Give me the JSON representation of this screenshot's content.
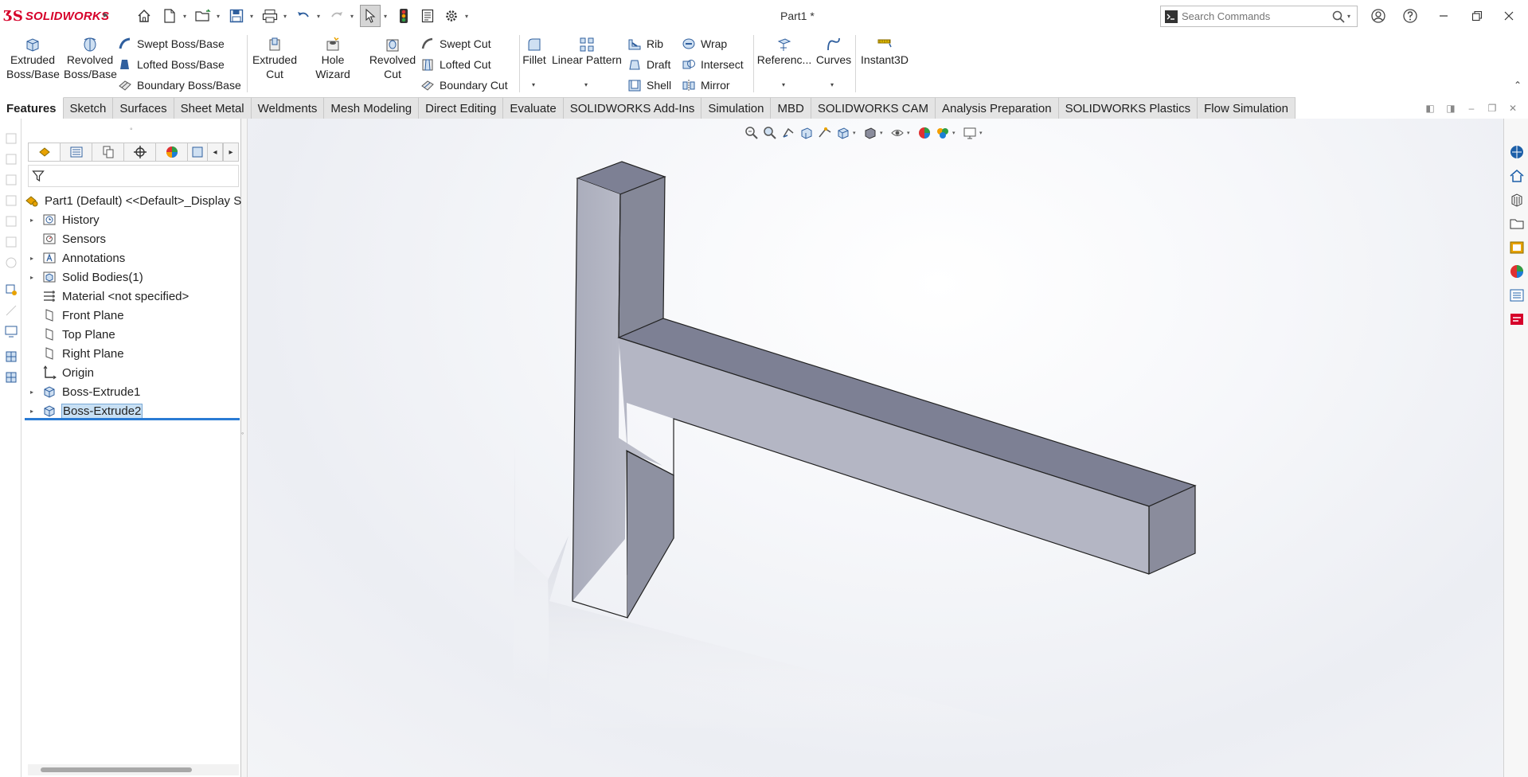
{
  "app": {
    "logo_text": "SOLIDWORKS",
    "document_title": "Part1 *"
  },
  "search": {
    "placeholder": "Search Commands",
    "value": ""
  },
  "commands": {
    "extruded_boss": "Extruded\nBoss/Base",
    "revolved_boss": "Revolved\nBoss/Base",
    "swept_boss": "Swept Boss/Base",
    "lofted_boss": "Lofted Boss/Base",
    "boundary_boss": "Boundary Boss/Base",
    "extruded_cut": "Extruded\nCut",
    "hole_wizard": "Hole Wizard",
    "revolved_cut": "Revolved\nCut",
    "swept_cut": "Swept Cut",
    "lofted_cut": "Lofted Cut",
    "boundary_cut": "Boundary Cut",
    "fillet": "Fillet",
    "linear_pattern": "Linear Pattern",
    "rib": "Rib",
    "draft": "Draft",
    "shell": "Shell",
    "wrap": "Wrap",
    "intersect": "Intersect",
    "mirror": "Mirror",
    "reference": "Referenc...",
    "curves": "Curves",
    "instant3d": "Instant3D"
  },
  "tabs": [
    {
      "label": "Features",
      "active": true
    },
    {
      "label": "Sketch"
    },
    {
      "label": "Surfaces"
    },
    {
      "label": "Sheet Metal"
    },
    {
      "label": "Weldments"
    },
    {
      "label": "Mesh Modeling"
    },
    {
      "label": "Direct Editing"
    },
    {
      "label": "Evaluate"
    },
    {
      "label": "SOLIDWORKS Add-Ins"
    },
    {
      "label": "Simulation"
    },
    {
      "label": "MBD"
    },
    {
      "label": "SOLIDWORKS CAM"
    },
    {
      "label": "Analysis Preparation"
    },
    {
      "label": "SOLIDWORKS Plastics"
    },
    {
      "label": "Flow Simulation"
    }
  ],
  "tree": {
    "root": "Part1 (Default) <<Default>_Display S",
    "items": [
      {
        "label": "History",
        "expandable": true
      },
      {
        "label": "Sensors",
        "expandable": false
      },
      {
        "label": "Annotations",
        "expandable": true
      },
      {
        "label": "Solid Bodies(1)",
        "expandable": true
      },
      {
        "label": "Material <not specified>",
        "expandable": false
      },
      {
        "label": "Front Plane",
        "expandable": false
      },
      {
        "label": "Top Plane",
        "expandable": false
      },
      {
        "label": "Right Plane",
        "expandable": false
      },
      {
        "label": "Origin",
        "expandable": false
      },
      {
        "label": "Boss-Extrude1",
        "expandable": true
      },
      {
        "label": "Boss-Extrude2",
        "expandable": true,
        "selected": true
      }
    ]
  },
  "colors": {
    "brand_red": "#d6002a",
    "selection_blue": "#2a7bd4",
    "part_top": "#7c7f93",
    "part_front": "#b4b6c4",
    "part_side": "#8a8c9c"
  }
}
